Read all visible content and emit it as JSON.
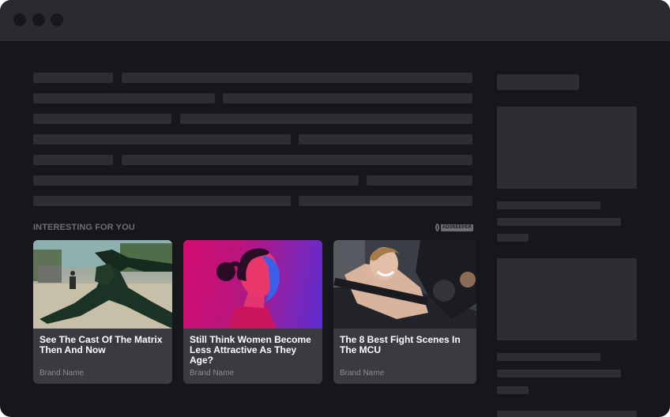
{
  "window": {
    "controls": [
      "close-dot",
      "minimize-dot",
      "maximize-dot"
    ]
  },
  "section": {
    "label": "INTERESTING FOR YOU",
    "brand_logo_text": "ADSKEEPER"
  },
  "cards": [
    {
      "title": "See The Cast Of The Matrix Then And Now",
      "brand": "Brand Name"
    },
    {
      "title": "Still Think Women Become Less Attractive As They Age?",
      "brand": "Brand Name"
    },
    {
      "title": "The 8 Best Fight Scenes In The MCU",
      "brand": "Brand Name"
    }
  ],
  "colors": {
    "background": "#16171b",
    "titlebar": "#2a2b2f",
    "placeholder": "#2d2e33",
    "card": "#3a3b40",
    "card_title": "#ffffff",
    "muted_text": "#8a8c92"
  }
}
